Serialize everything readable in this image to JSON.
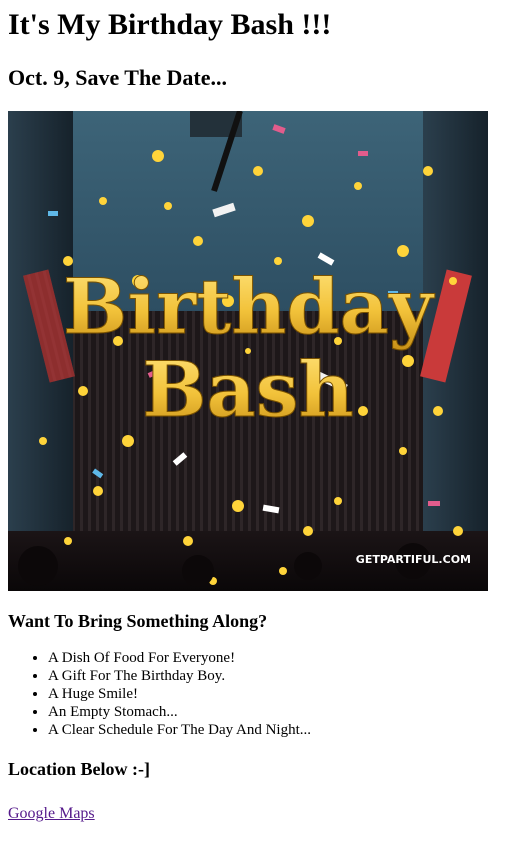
{
  "heading": "It's My Birthday Bash !!!",
  "subheading": "Oct. 9, Save The Date...",
  "image": {
    "title_line1": "Birthday",
    "title_line2": "Bash",
    "watermark": "GETPARTIFUL.COM"
  },
  "bring": {
    "title": "Want To Bring Something Along?",
    "items": [
      "A Dish Of Food For Everyone!",
      "A Gift For The Birthday Boy.",
      "A Huge Smile!",
      "An Empty Stomach...",
      "A Clear Schedule For The Day And Night..."
    ]
  },
  "location": {
    "title": "Location Below :-]",
    "link_label": "Google Maps"
  },
  "colors": {
    "link_visited": "#551a8b",
    "title_gold": "#f4c542"
  }
}
